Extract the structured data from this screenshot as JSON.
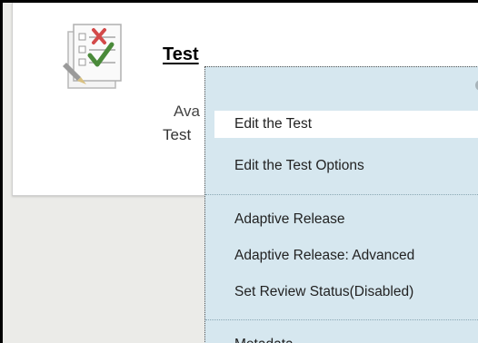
{
  "item": {
    "title": "Test",
    "availability": "Ava",
    "description": "Test"
  },
  "menu": {
    "items": [
      {
        "label": "Edit the Test"
      },
      {
        "label": "Edit the Test Options"
      },
      {
        "label": "Adaptive Release"
      },
      {
        "label": "Adaptive Release: Advanced"
      },
      {
        "label": "Set Review Status(Disabled)"
      },
      {
        "label": "Metadata"
      }
    ]
  },
  "colors": {
    "menu_background": "#d6e7ef",
    "card_background": "#ffffff",
    "page_background": "#ebebe8"
  },
  "icons": {
    "item_icon": "test-checklist-icon"
  }
}
